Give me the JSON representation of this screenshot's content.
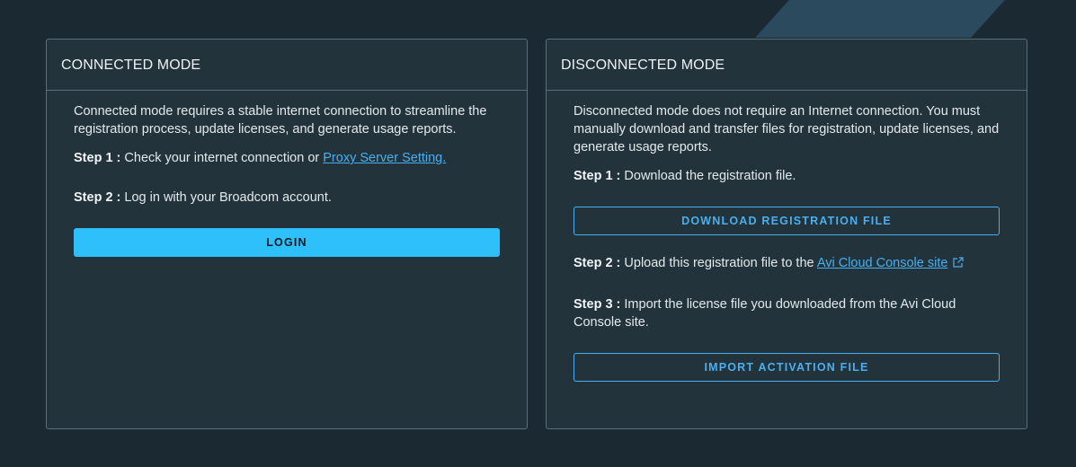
{
  "connected": {
    "title": "CONNECTED MODE",
    "description": "Connected mode requires a stable internet connection to streamline the registration process, update licenses, and generate usage reports.",
    "step1_label": "Step 1 :",
    "step1_text": " Check your internet connection or ",
    "step1_link": "Proxy Server Setting.",
    "step2_label": "Step 2 :",
    "step2_text": " Log in with your Broadcom account.",
    "login_label": "LOGIN"
  },
  "disconnected": {
    "title": "DISCONNECTED MODE",
    "description": "Disconnected mode does not require an Internet connection. You must manually download and transfer files for registration, update licenses, and generate usage reports.",
    "step1_label": "Step 1 :",
    "step1_text": " Download the registration file.",
    "download_label": "DOWNLOAD REGISTRATION FILE",
    "step2_label": "Step 2 :",
    "step2_text": " Upload this registration file to the ",
    "step2_link": "Avi Cloud Console site",
    "step3_label": "Step 3 :",
    "step3_text": " Import the license file you downloaded from the Avi Cloud Console site.",
    "import_label": "IMPORT ACTIVATION FILE"
  },
  "icons": {
    "external_link": "external-link-icon"
  },
  "colors": {
    "accent": "#2ec0fb",
    "link": "#49aff0",
    "background": "#1b2a32",
    "panel": "#22333b"
  }
}
